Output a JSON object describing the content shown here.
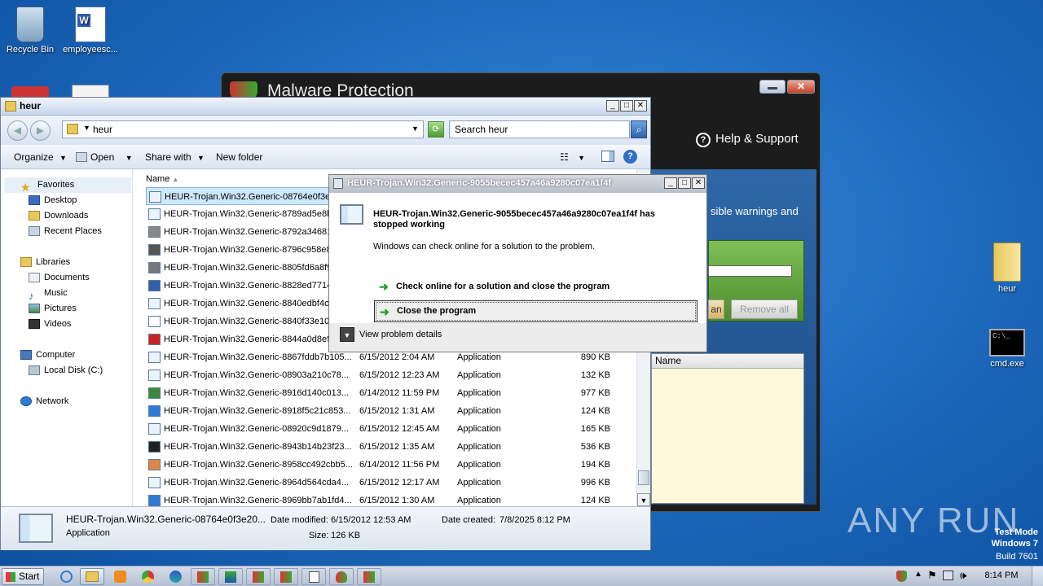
{
  "desktop": {
    "icons": [
      {
        "label": "Recycle Bin"
      },
      {
        "label": "employeesc..."
      },
      {
        "label": "heur"
      },
      {
        "label": "cmd.exe"
      }
    ]
  },
  "malware_window": {
    "title": "Malware Protection",
    "help_support": "Help & Support",
    "warning_text": "sible warnings and",
    "clean_btn": "an",
    "remove_all_btn": "Remove all",
    "table_header": "Name"
  },
  "explorer": {
    "title": "heur",
    "address": "heur",
    "search_placeholder": "Search heur",
    "toolbar": {
      "organize": "Organize",
      "open": "Open",
      "share_with": "Share with",
      "new_folder": "New folder"
    },
    "nav": {
      "favorites": "Favorites",
      "desktop": "Desktop",
      "downloads": "Downloads",
      "recent_places": "Recent Places",
      "libraries": "Libraries",
      "documents": "Documents",
      "music": "Music",
      "pictures": "Pictures",
      "videos": "Videos",
      "computer": "Computer",
      "local_disk": "Local Disk (C:)",
      "network": "Network"
    },
    "column_name": "Name",
    "files": [
      {
        "name": "HEUR-Trojan.Win32.Generic-08764e0f3e2",
        "date": "",
        "type": "",
        "size": ""
      },
      {
        "name": "HEUR-Trojan.Win32.Generic-8789ad5e8be",
        "date": "",
        "type": "",
        "size": ""
      },
      {
        "name": "HEUR-Trojan.Win32.Generic-8792a346819",
        "date": "",
        "type": "",
        "size": ""
      },
      {
        "name": "HEUR-Trojan.Win32.Generic-8796c958e87",
        "date": "",
        "type": "",
        "size": ""
      },
      {
        "name": "HEUR-Trojan.Win32.Generic-8805fd6a8f9",
        "date": "",
        "type": "",
        "size": ""
      },
      {
        "name": "HEUR-Trojan.Win32.Generic-8828ed77140",
        "date": "",
        "type": "",
        "size": ""
      },
      {
        "name": "HEUR-Trojan.Win32.Generic-8840edbf4c7",
        "date": "",
        "type": "",
        "size": ""
      },
      {
        "name": "HEUR-Trojan.Win32.Generic-8840f33e101",
        "date": "",
        "type": "",
        "size": ""
      },
      {
        "name": "HEUR-Trojan.Win32.Generic-8844a0d8e9",
        "date": "",
        "type": "",
        "size": ""
      },
      {
        "name": "HEUR-Trojan.Win32.Generic-8867fddb7b105...",
        "date": "6/15/2012 2:04 AM",
        "type": "Application",
        "size": "890 KB"
      },
      {
        "name": "HEUR-Trojan.Win32.Generic-08903a210c78...",
        "date": "6/15/2012 12:23 AM",
        "type": "Application",
        "size": "132 KB"
      },
      {
        "name": "HEUR-Trojan.Win32.Generic-8916d140c013...",
        "date": "6/14/2012 11:59 PM",
        "type": "Application",
        "size": "977 KB"
      },
      {
        "name": "HEUR-Trojan.Win32.Generic-8918f5c21c853...",
        "date": "6/15/2012 1:31 AM",
        "type": "Application",
        "size": "124 KB"
      },
      {
        "name": "HEUR-Trojan.Win32.Generic-08920c9d1879...",
        "date": "6/15/2012 12:45 AM",
        "type": "Application",
        "size": "165 KB"
      },
      {
        "name": "HEUR-Trojan.Win32.Generic-8943b14b23f23...",
        "date": "6/15/2012 1:35 AM",
        "type": "Application",
        "size": "536 KB"
      },
      {
        "name": "HEUR-Trojan.Win32.Generic-8958cc492cbb5...",
        "date": "6/14/2012 11:56 PM",
        "type": "Application",
        "size": "194 KB"
      },
      {
        "name": "HEUR-Trojan.Win32.Generic-8964d564cda4...",
        "date": "6/15/2012 12:17 AM",
        "type": "Application",
        "size": "996 KB"
      },
      {
        "name": "HEUR-Trojan.Win32.Generic-8969bb7ab1fd4...",
        "date": "6/15/2012 1:30 AM",
        "type": "Application",
        "size": "124 KB"
      }
    ],
    "details": {
      "name": "HEUR-Trojan.Win32.Generic-08764e0f3e20...",
      "type": "Application",
      "date_modified_label": "Date modified:",
      "date_modified": "6/15/2012 12:53 AM",
      "date_created_label": "Date created:",
      "date_created": "7/8/2025 8:12 PM",
      "size_label": "Size:",
      "size": "126 KB"
    }
  },
  "dialog": {
    "title": "HEUR-Trojan.Win32.Generic-9055becec457a46a9280c07ea1f4f",
    "heading": "HEUR-Trojan.Win32.Generic-9055becec457a46a9280c07ea1f4f has stopped working",
    "message": "Windows can check online for a solution to the problem.",
    "option_check": "Check online for a solution and close the program",
    "option_close": "Close the program",
    "view_details": "View problem details"
  },
  "taskbar": {
    "start": "Start",
    "clock": "8:14 PM"
  },
  "watermark": {
    "brand": "ANY RUN",
    "mode": "Test Mode",
    "os": "Windows 7",
    "build": "Build 7601"
  }
}
